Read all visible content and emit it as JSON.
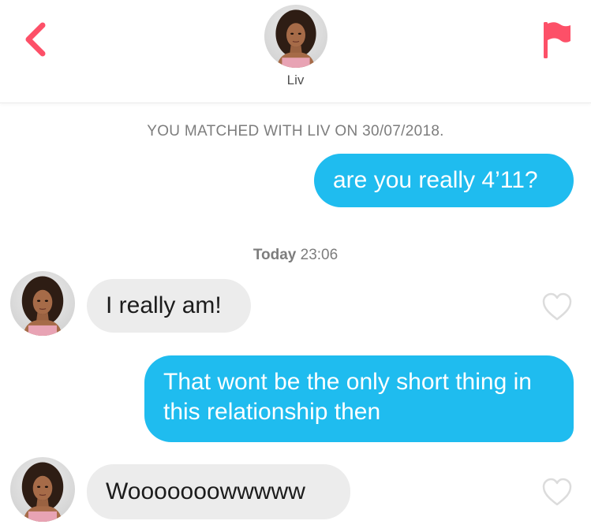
{
  "header": {
    "name": "Liv",
    "back_icon": "chevron-left-icon",
    "flag_icon": "flag-icon"
  },
  "conversation": {
    "match_text": "YOU MATCHED WITH LIV ON 30/07/2018.",
    "time_day": "Today",
    "time_clock": "23:06",
    "messages": [
      {
        "sender": "me",
        "text": "are you really 4’11?"
      },
      {
        "sender": "Liv",
        "text": "I really am!"
      },
      {
        "sender": "me",
        "text": "That wont be the only short thing in this relationship then"
      },
      {
        "sender": "Liv",
        "text": "Wooooooowwwww"
      }
    ]
  },
  "colors": {
    "accent": "#fd5068",
    "outgoing_bubble": "#1fbcef",
    "incoming_bubble": "#ececec",
    "system_text": "#7d7d7d"
  }
}
